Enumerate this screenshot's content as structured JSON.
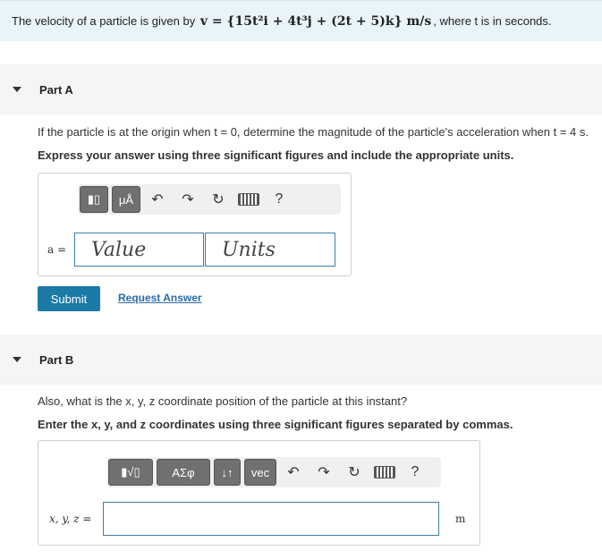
{
  "problem": {
    "prefix": "The velocity of a particle is given by",
    "formula": "v = {15t²i + 4t³j + (2t + 5)k} m/s",
    "suffix": ", where t is in seconds."
  },
  "partA": {
    "title": "Part A",
    "question": "If the particle is at the origin when t = 0, determine the magnitude of the particle's acceleration when t = 4 s.",
    "instruction": "Express your answer using three significant figures and include the appropriate units.",
    "toolbar": {
      "mu": "μÅ",
      "help": "?"
    },
    "variable": "a =",
    "value_placeholder": "Value",
    "units_placeholder": "Units",
    "submit": "Submit",
    "request": "Request Answer"
  },
  "partB": {
    "title": "Part B",
    "question": "Also, what is the x, y, z coordinate position of the particle at this instant?",
    "instruction": "Enter the x, y, and z coordinates using three significant figures separated by commas.",
    "toolbar": {
      "sigma": "ΑΣφ",
      "vec": "vec",
      "help": "?"
    },
    "variable": "x, y, z =",
    "unit": "m"
  }
}
